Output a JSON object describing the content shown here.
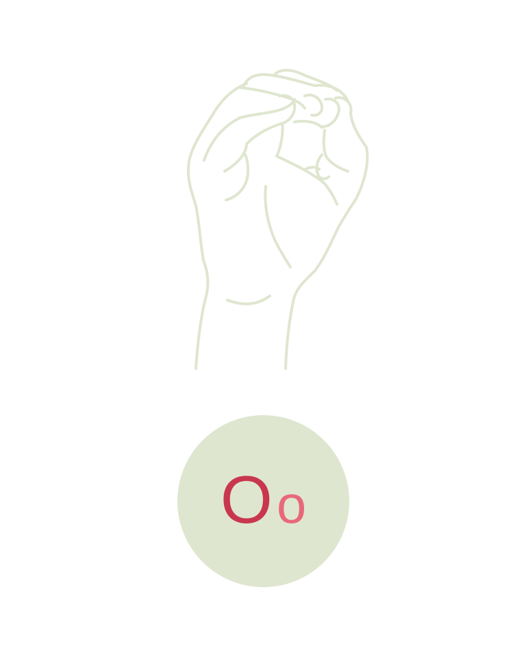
{
  "letter": {
    "uppercase": "O",
    "lowercase": "o"
  },
  "illustration": {
    "icon": "hand-sign-letter-o-icon",
    "stroke_color": "#dfe6cf"
  },
  "colors": {
    "background": "#ffffff",
    "badge_fill": "#dfe6cf",
    "uppercase_color": "#c8374e",
    "lowercase_color": "#e8687a"
  }
}
